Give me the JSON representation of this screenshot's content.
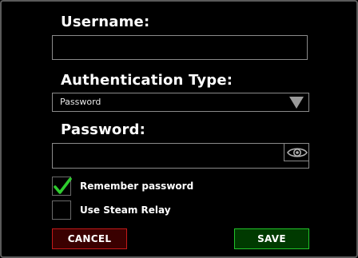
{
  "form": {
    "username": {
      "label": "Username:",
      "value": ""
    },
    "auth_type": {
      "label": "Authentication Type:",
      "selected": "Password"
    },
    "password": {
      "label": "Password:",
      "value": "",
      "reveal_icon": "eye-icon"
    },
    "remember_password": {
      "label": "Remember password",
      "checked": true
    },
    "use_steam_relay": {
      "label": "Use Steam Relay",
      "checked": false
    }
  },
  "actions": {
    "cancel_label": "CANCEL",
    "save_label": "SAVE"
  },
  "colors": {
    "background": "#000000",
    "border": "#8a8a8a",
    "check": "#2ecc2e",
    "cancel_border": "#c41a1a",
    "cancel_fill": "#3a0000",
    "save_border": "#22c42a",
    "save_fill": "#003a00"
  }
}
